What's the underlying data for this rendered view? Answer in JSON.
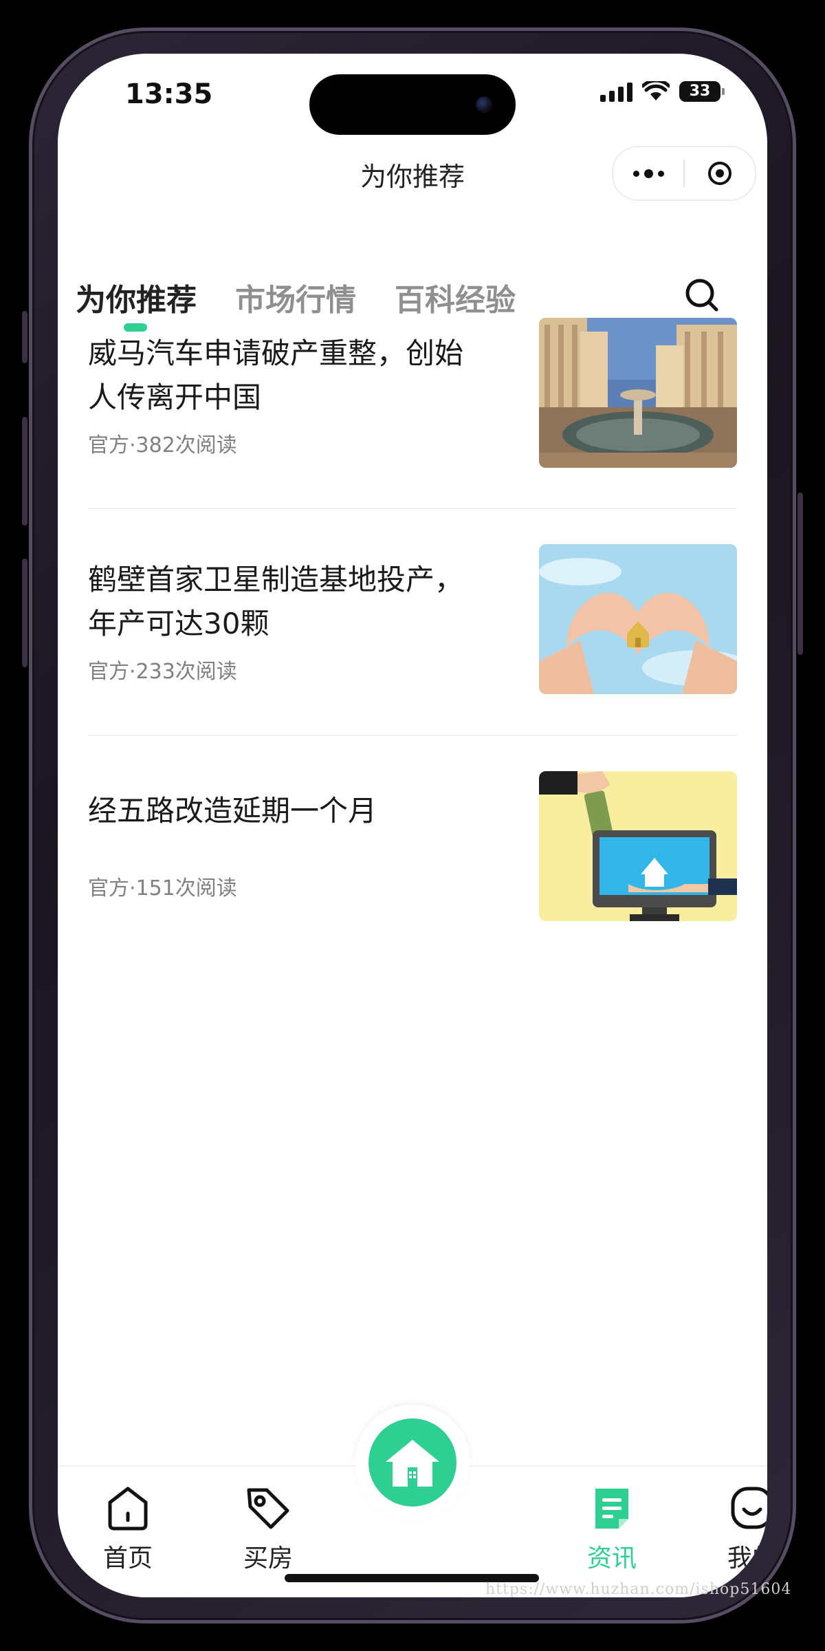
{
  "status_bar": {
    "time": "13:35",
    "battery": "33"
  },
  "nav": {
    "title": "为你推荐"
  },
  "tabs": [
    {
      "label": "为你推荐"
    },
    {
      "label": "市场行情"
    },
    {
      "label": "百科经验"
    }
  ],
  "articles": [
    {
      "title": "威马汽车申请破产重整，创始人传离开中国",
      "meta": "官方·382次阅读"
    },
    {
      "title": "鹤壁首家卫星制造基地投产，年产可达30颗",
      "meta": "官方·233次阅读"
    },
    {
      "title": "经五路改造延期一个月",
      "meta": "官方·151次阅读"
    }
  ],
  "tabbar": {
    "home": "首页",
    "buy": "买房",
    "news": "资讯",
    "mine": "我的"
  },
  "colors": {
    "accent": "#2fcf93"
  },
  "watermark": "https://www.huzhan.com/ishop51604"
}
